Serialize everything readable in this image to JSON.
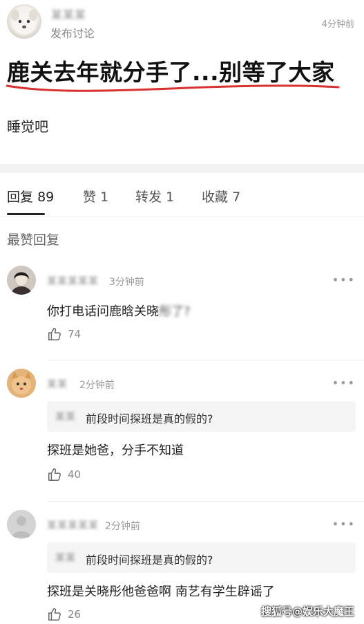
{
  "post": {
    "author": "某某某",
    "subtitle": "发布讨论",
    "time": "4分钟前",
    "title": "鹿关去年就分手了...别等了大家",
    "body": "睡觉吧"
  },
  "tabs": [
    {
      "label": "回复",
      "count": "89"
    },
    {
      "label": "赞",
      "count": "1"
    },
    {
      "label": "转发",
      "count": "1"
    },
    {
      "label": "收藏",
      "count": "7"
    }
  ],
  "section_label": "最赞回复",
  "comments": [
    {
      "name": "某某某某某",
      "time": "3分钟前",
      "text": "你打电话问鹿晗关晓",
      "text_blurred": "彤了?",
      "likes": "74"
    },
    {
      "name": "某某",
      "time": "2分钟前",
      "quote_name": "某某",
      "quote": "前段时间探班是真的假的?",
      "text": "探班是她爸，分手不知道",
      "likes": "40"
    },
    {
      "name": "某某某某某",
      "time": "2分钟前",
      "quote_name": "某某",
      "quote": "前段时间探班是真的假的?",
      "text": "探班是关晓彤他爸爸啊 南艺有学生辟谣了",
      "likes": "26"
    }
  ],
  "watermark": "搜狐号@娱乐大魔王",
  "colors": {
    "underline_red": "#d93030",
    "background": "#ffffff",
    "band": "#f2f2f2"
  }
}
